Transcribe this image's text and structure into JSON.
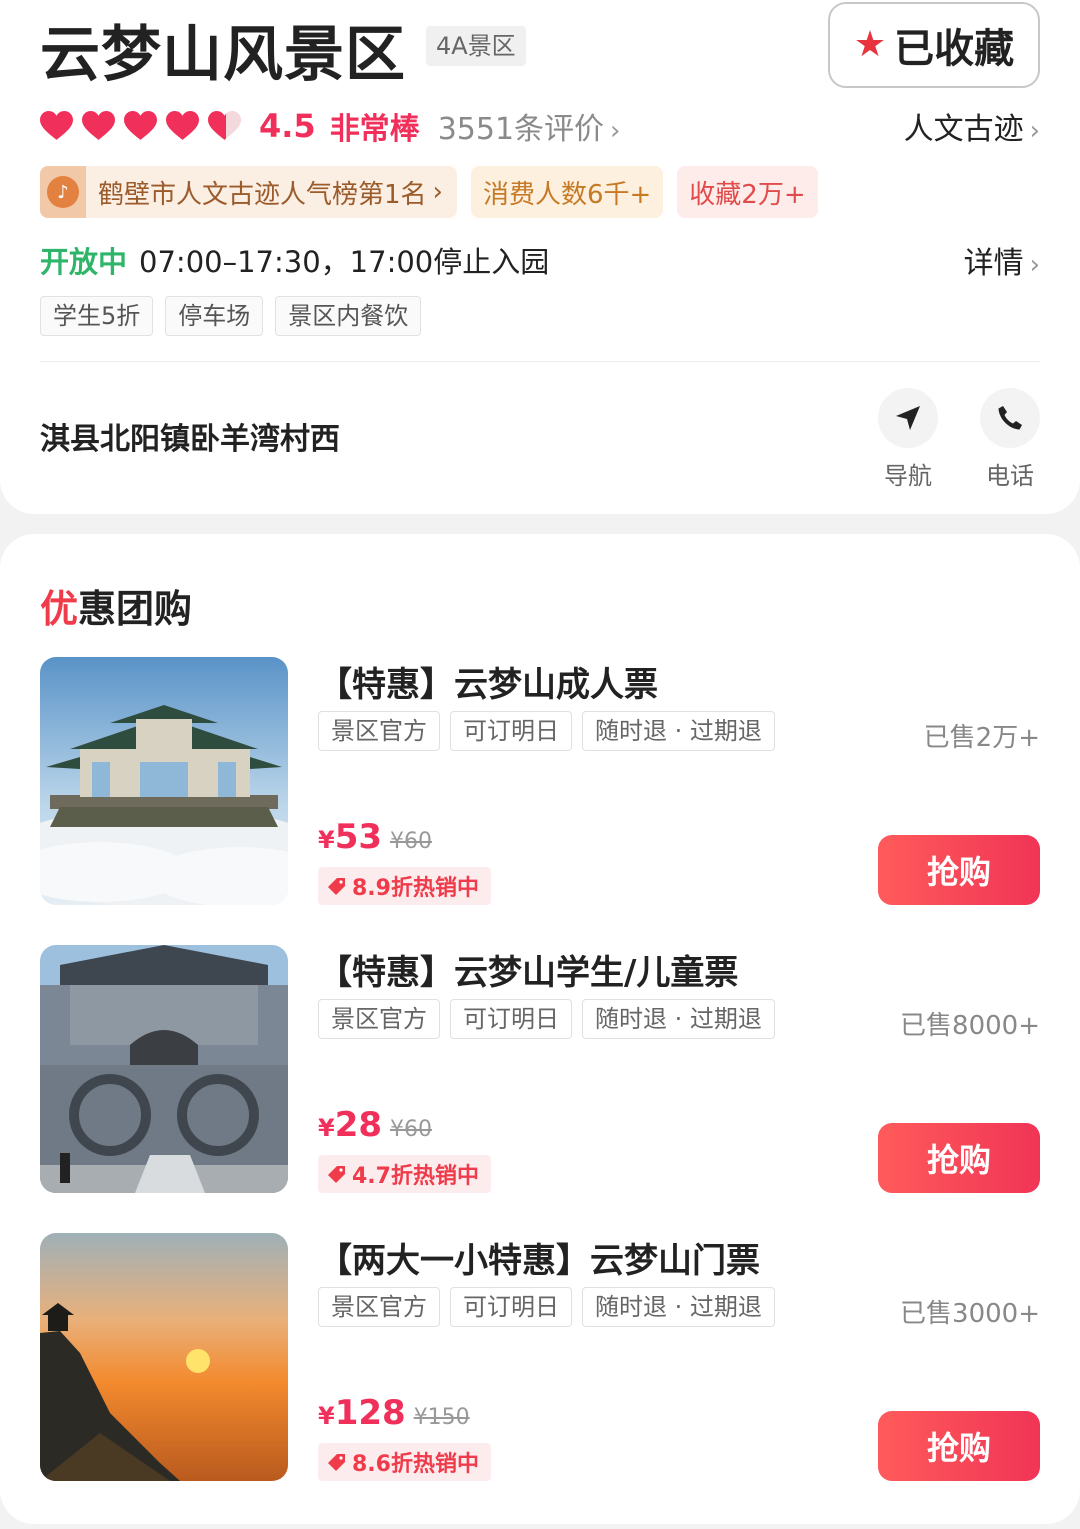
{
  "header": {
    "title": "云梦山风景区",
    "level_badge": "4A景区",
    "favorite_label": "已收藏"
  },
  "rating": {
    "hearts_total": 5,
    "score": "4.5",
    "score_word": "非常棒",
    "reviews": "3551条评价",
    "category": "人文古迹"
  },
  "badges": {
    "hot_rank": "鹤壁市人文古迹人气榜第1名",
    "hot_rank_icon": "douyin-icon",
    "consumers": "消费人数6千+",
    "favorites": "收藏2万+"
  },
  "hours": {
    "status": "开放中",
    "text": "07:00–17:30，17:00停止入园",
    "detail_label": "详情"
  },
  "facilities": [
    "学生5折",
    "停车场",
    "景区内餐饮"
  ],
  "location": {
    "address": "淇县北阳镇卧羊湾村西",
    "nav_label": "导航",
    "call_label": "电话"
  },
  "deals_section": {
    "title_accent": "优",
    "title_rest": "惠团购",
    "items": [
      {
        "name": "【特惠】云梦山成人票",
        "tags": [
          "景区官方",
          "可订明日",
          "随时退 · 过期退"
        ],
        "sold": "已售2万+",
        "currency": "¥",
        "price": "53",
        "original_price": "¥60",
        "discount": "8.9折热销中",
        "buy_label": "抢购"
      },
      {
        "name": "【特惠】云梦山学生/儿童票",
        "tags": [
          "景区官方",
          "可订明日",
          "随时退 · 过期退"
        ],
        "sold": "已售8000+",
        "currency": "¥",
        "price": "28",
        "original_price": "¥60",
        "discount": "4.7折热销中",
        "buy_label": "抢购"
      },
      {
        "name": "【两大一小特惠】云梦山门票",
        "tags": [
          "景区官方",
          "可订明日",
          "随时退 · 过期退"
        ],
        "sold": "已售3000+",
        "currency": "¥",
        "price": "128",
        "original_price": "¥150",
        "discount": "8.6折热销中",
        "buy_label": "抢购"
      }
    ]
  },
  "colors": {
    "accent_red": "#f0305a",
    "open_green": "#2fb56a",
    "hot_tag_bg": "#fbeee3"
  }
}
